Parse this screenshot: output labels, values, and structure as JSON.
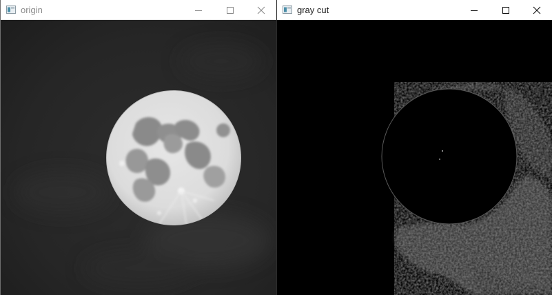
{
  "windows": [
    {
      "title": "origin",
      "icon": "opencv-window-icon",
      "controls": [
        "minimize-icon",
        "maximize-icon",
        "close-icon"
      ],
      "content": "moon-photo"
    },
    {
      "title": "gray cut",
      "icon": "opencv-window-icon",
      "controls": [
        "minimize-icon",
        "maximize-icon",
        "close-icon"
      ],
      "content": "thresholded-moon-image"
    }
  ],
  "colors": {
    "titlebar_bg": "#ffffff",
    "inactive_title": "#8a8a8a",
    "active_title": "#1a1a1a",
    "image_bg": "#000000"
  }
}
